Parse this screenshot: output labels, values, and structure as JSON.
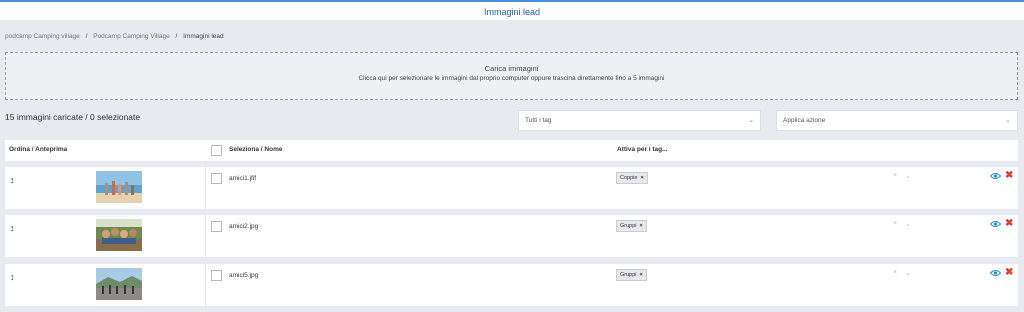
{
  "header": {
    "title": "Immagini lead"
  },
  "breadcrumb": {
    "items": [
      "podcamp Camping village",
      "Podcamp Camping Village"
    ],
    "current": "Immagini lead",
    "separator": "/"
  },
  "upload": {
    "title": "Carica immagini",
    "subtitle": "Clicca qui per selezionare le immagini dal proprio computer oppure trascina direttamente fino a 5 immagini"
  },
  "summary": {
    "count_text": "15 immagini caricate / 0 selezionate"
  },
  "filters": {
    "tag_select": "Tutti i tag",
    "action_select": "Applica azione"
  },
  "table": {
    "headers": {
      "order_preview": "Ordina / Anteprima",
      "select_name": "Seleziona / Nome",
      "active_tags": "Attiva per i tag..."
    },
    "rows": [
      {
        "filename": "amici1.jfif",
        "tag": "Coppie"
      },
      {
        "filename": "amici2.jpg",
        "tag": "Gruppi"
      },
      {
        "filename": "amici5.jpg",
        "tag": "Gruppi"
      }
    ]
  },
  "colors": {
    "accent": "#4a90d9",
    "title": "#2a5a9c",
    "delete": "#e03c31",
    "eye": "#2a8fd6"
  },
  "icons": {
    "handle": "drag-handle-icon",
    "eye": "eye-icon",
    "delete": "delete-icon",
    "chevron": "chevron-down-icon",
    "clear": "clear-icon"
  }
}
